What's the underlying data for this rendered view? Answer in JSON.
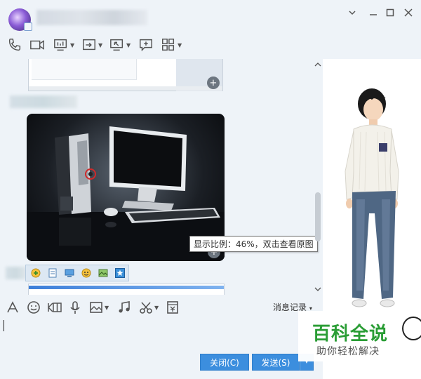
{
  "window": {
    "contact_name": "",
    "controls": {
      "settings": "▾",
      "minimize": "—",
      "maximize": "□",
      "close": "✕"
    }
  },
  "toolbar": {
    "items": [
      {
        "icon": "phone-icon"
      },
      {
        "icon": "video-icon"
      },
      {
        "icon": "screen-share-icon",
        "dropdown": true
      },
      {
        "icon": "file-transfer-icon",
        "dropdown": true
      },
      {
        "icon": "remote-desktop-icon",
        "dropdown": true
      },
      {
        "icon": "new-chat-icon"
      },
      {
        "icon": "apps-icon",
        "dropdown": true
      }
    ]
  },
  "chat": {
    "tooltip": "显示比例：46%，双击查看原图",
    "zoom_symbol": "+"
  },
  "input_toolbar": {
    "history_label": "消息记录",
    "history_caret": "▾"
  },
  "buttons": {
    "close_label": "关闭(C)",
    "send_label": "发送(S)",
    "send_caret": "▾"
  },
  "watermark": {
    "title": "百科全说",
    "subtitle": "助你轻松解决"
  },
  "colors": {
    "accent": "#3c8ede",
    "background": "#eef3f8",
    "watermark_green": "#2a9d35"
  }
}
